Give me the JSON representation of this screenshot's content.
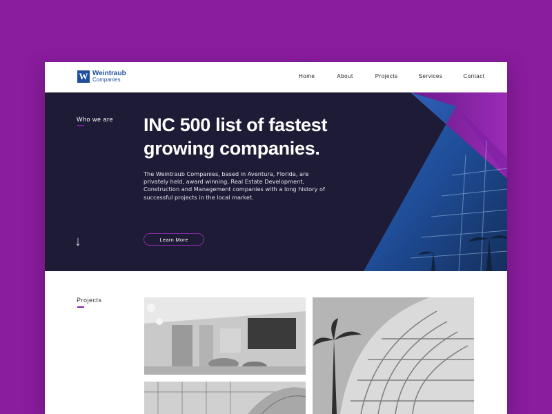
{
  "colors": {
    "background": "#8a1c9e",
    "hero_bg": "#1e1b36",
    "accent_purple": "#7b1fa2",
    "accent_blue": "#1f4f9c"
  },
  "header": {
    "logo": {
      "mark": "W",
      "name": "Weintraub",
      "sub": "Companies"
    },
    "nav": [
      "Home",
      "About",
      "Projects",
      "Services",
      "Contact"
    ]
  },
  "hero": {
    "section_label": "Who we are",
    "title_line1": "INC 500 list of fastest",
    "title_line2": "growing companies.",
    "description": "The Weintraub Companies, based in Aventura, Florida, are privately held, award winning, Real Estate Development, Construction and Management companies with a long history of successful projects in the local market.",
    "button": "Learn More",
    "arrow_icon": "arrow-down-icon"
  },
  "projects": {
    "section_label": "Projects",
    "images": [
      "lobby-photo",
      "tower-photo",
      "atrium-photo"
    ]
  }
}
